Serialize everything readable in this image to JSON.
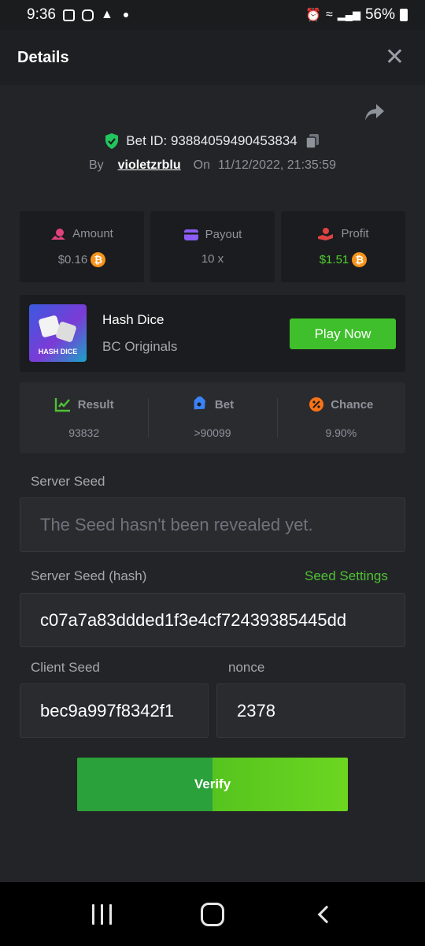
{
  "status_bar": {
    "time": "9:36",
    "battery": "56%"
  },
  "header": {
    "title": "Details"
  },
  "bet": {
    "id_label": "Bet ID: 93884059490453834",
    "by_label": "By",
    "username": "violetzrblu",
    "on_label": "On",
    "date": "11/12/2022, 21:35:59"
  },
  "stats": [
    {
      "label": "Amount",
      "value": "$0.16",
      "icon": "coins-icon",
      "color": "#e0427a"
    },
    {
      "label": "Payout",
      "value": "10 x",
      "icon": "wallet-icon",
      "color": "#8b5cf6"
    },
    {
      "label": "Profit",
      "value": "$1.51",
      "icon": "hand-coin-icon",
      "color": "#e04242"
    }
  ],
  "game": {
    "name": "Hash Dice",
    "provider": "BC Originals",
    "thumb_label": "HASH DICE",
    "play_label": "Play Now"
  },
  "results": [
    {
      "label": "Result",
      "value": "93832",
      "icon": "chart-check-icon",
      "color": "#4fc134"
    },
    {
      "label": "Bet",
      "value": ">90099",
      "icon": "tag-icon",
      "color": "#3b82f6"
    },
    {
      "label": "Chance",
      "value": "9.90%",
      "icon": "percent-icon",
      "color": "#f97316"
    }
  ],
  "seeds": {
    "server_seed_label": "Server Seed",
    "server_seed_value": "The Seed hasn't been revealed yet.",
    "server_hash_label": "Server Seed (hash)",
    "seed_settings_label": "Seed Settings",
    "server_hash_value": "c07a7a83ddded1f3e4cf72439385445dd",
    "client_seed_label": "Client Seed",
    "client_seed_value": "bec9a997f8342f1",
    "nonce_label": "nonce",
    "nonce_value": "2378"
  },
  "verify_label": "Verify",
  "colors": {
    "accent_green": "#3fbf2b",
    "background": "#232427",
    "card": "#1b1c1f"
  }
}
